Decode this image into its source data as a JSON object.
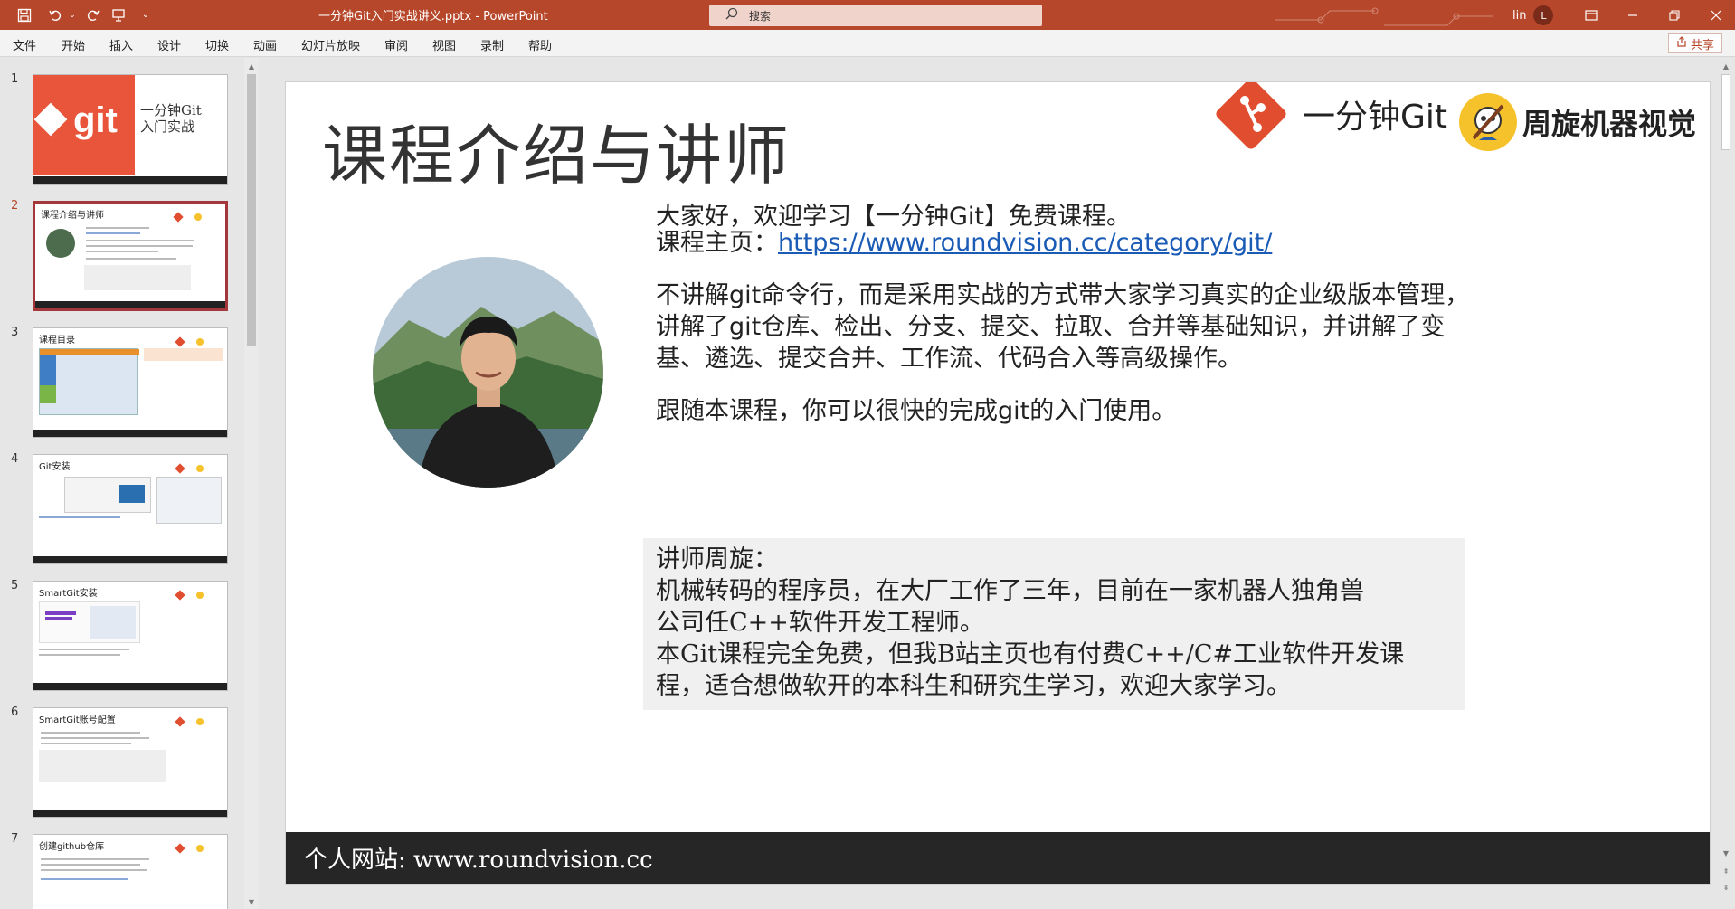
{
  "titlebar": {
    "document_title": "一分钟Git入门实战讲义.pptx  -  PowerPoint",
    "search_placeholder": "搜索",
    "user_name": "lin",
    "user_initial": "L",
    "accent_color": "#b7472a",
    "quick_access_icons": [
      "save-icon",
      "undo-icon",
      "undo-dropdown-icon",
      "redo-icon",
      "present-icon",
      "customize-icon"
    ],
    "window_icons": [
      "ribbon-display-icon",
      "minimize-icon",
      "restore-icon",
      "close-icon"
    ]
  },
  "menu": {
    "items": [
      "文件",
      "开始",
      "插入",
      "设计",
      "切换",
      "动画",
      "幻灯片放映",
      "审阅",
      "视图",
      "录制",
      "帮助"
    ],
    "share_label": "共享"
  },
  "thumbnails": [
    {
      "number": "1",
      "title": "一分钟Git入门实战",
      "active": false
    },
    {
      "number": "2",
      "title": "课程介绍与讲师",
      "active": true
    },
    {
      "number": "3",
      "title": "课程目录",
      "active": false
    },
    {
      "number": "4",
      "title": "Git安装",
      "active": false
    },
    {
      "number": "5",
      "title": "SmartGit安装",
      "active": false
    },
    {
      "number": "6",
      "title": "SmartGit账号配置",
      "active": false
    },
    {
      "number": "7",
      "title": "创建github仓库",
      "active": false
    }
  ],
  "thumb1": {
    "logo_text": "git",
    "title_line1": "一分钟Git",
    "title_line2": "入门实战"
  },
  "slide": {
    "title": "课程介绍与讲师",
    "brand1": "一分钟Git",
    "brand2": "周旋机器视觉",
    "intro_line1": "大家好，欢迎学习【一分钟Git】免费课程。",
    "homepage_label": "课程主页：",
    "homepage_url": "https://www.roundvision.cc/category/git/",
    "para2_line1": "不讲解git命令行，而是采用实战的方式带大家学习真实的企业级版本管理，",
    "para2_line2": "讲解了git仓库、检出、分支、提交、拉取、合并等基础知识，并讲解了变",
    "para2_line3": "基、遴选、提交合并、工作流、代码合入等高级操作。",
    "para3": "跟随本课程，你可以很快的完成git的入门使用。",
    "teacher_lines": [
      "讲师周旋：",
      "机械转码的程序员，在大厂工作了三年，目前在一家机器人独角兽",
      "公司任C++软件开发工程师。",
      "本Git课程完全免费，但我B站主页也有付费C++/C#工业软件开发课",
      "程，适合想做软开的本科生和研究生学习，欢迎大家学习。"
    ],
    "footer": "个人网站: www.roundvision.cc"
  }
}
